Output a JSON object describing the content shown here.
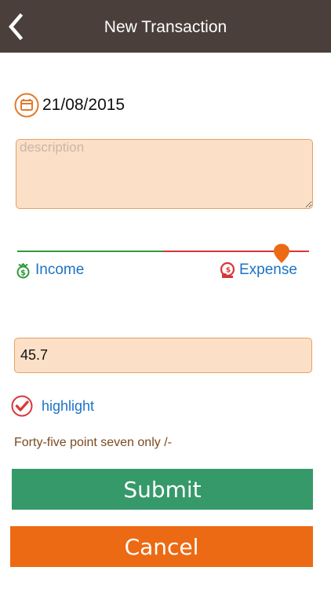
{
  "header": {
    "title": "New Transaction",
    "back_icon": "chevron-left-icon"
  },
  "date": {
    "value": "21/08/2015",
    "icon": "calendar-icon"
  },
  "description": {
    "value": "",
    "placeholder": "description"
  },
  "type_slider": {
    "income_label": "Income",
    "expense_label": "Expense",
    "income_icon": "money-bag-icon",
    "expense_icon": "hand-coin-icon",
    "value": 0.905,
    "selected": "Expense",
    "colors": {
      "income": "#2f9a3c",
      "expense": "#d8363a",
      "thumb": "#ec6a13"
    }
  },
  "amount": {
    "value": "45.7"
  },
  "highlight": {
    "label": "highlight",
    "checked": true,
    "icon": "checkmark-circle-icon"
  },
  "amount_in_words": "Forty-five point seven only /-",
  "buttons": {
    "submit_label": "Submit",
    "cancel_label": "Cancel"
  },
  "colors": {
    "header_bg": "#4a3f3a",
    "input_bg": "#fbe0c7",
    "input_border": "#e8a062",
    "submit_bg": "#36996a",
    "cancel_bg": "#ec6a13",
    "link": "#1b73c5"
  }
}
